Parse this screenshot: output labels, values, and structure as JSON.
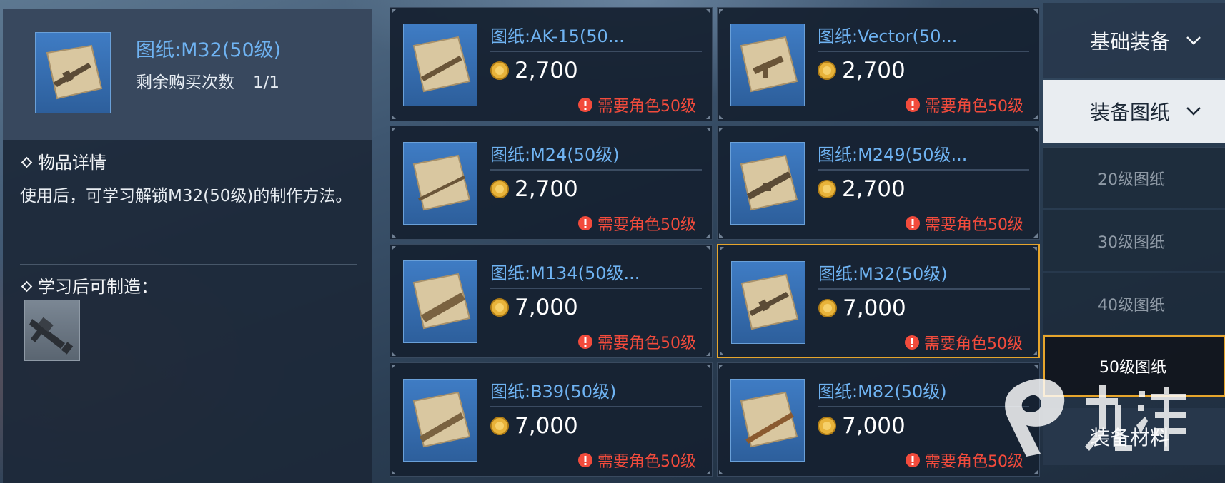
{
  "detail": {
    "title": "图纸:M32(50级)",
    "remaining_label": "剩余购买次数",
    "remaining_count": "1/1",
    "info_heading": "物品详情",
    "description": "使用后，可学习解锁M32(50级)的制作方法。",
    "craft_heading": "学习后可制造："
  },
  "items": [
    {
      "name": "图纸:AK-15(50...",
      "price": "2,700",
      "requirement": "需要角色50级"
    },
    {
      "name": "图纸:Vector(50...",
      "price": "2,700",
      "requirement": "需要角色50级"
    },
    {
      "name": "图纸:M24(50级)",
      "price": "2,700",
      "requirement": "需要角色50级"
    },
    {
      "name": "图纸:M249(50级...",
      "price": "2,700",
      "requirement": "需要角色50级"
    },
    {
      "name": "图纸:M134(50级...",
      "price": "7,000",
      "requirement": "需要角色50级"
    },
    {
      "name": "图纸:M32(50级)",
      "price": "7,000",
      "requirement": "需要角色50级",
      "selected": true
    },
    {
      "name": "图纸:B39(50级)",
      "price": "7,000",
      "requirement": "需要角色50级"
    },
    {
      "name": "图纸:M82(50级)",
      "price": "7,000",
      "requirement": "需要角色50级"
    }
  ],
  "menu": {
    "basic_equipment": "基础装备",
    "equipment_blueprints": "装备图纸",
    "sub_items": [
      "20级图纸",
      "30级图纸",
      "40级图纸",
      "50级图纸"
    ],
    "active_sub": "50级图纸",
    "equipment_materials": "装备材料"
  },
  "icons": {
    "coin": "gold-coin-icon",
    "warning": "exclamation-icon",
    "chevron": "chevron-down-icon"
  },
  "colors": {
    "item_name": "#6fb3f2",
    "requirement": "#f24b3c",
    "selected_border": "#e6a52c",
    "coin": "#e8b33a"
  }
}
